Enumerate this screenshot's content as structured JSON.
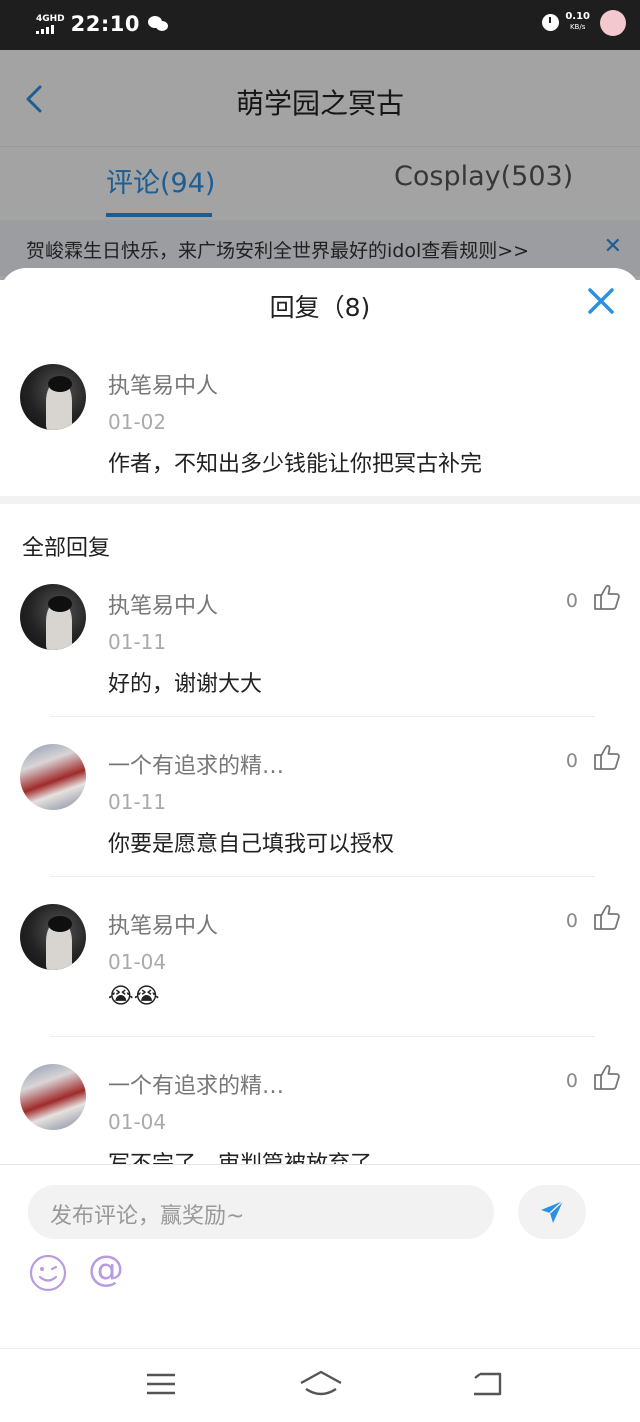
{
  "status_bar": {
    "network": "4GHD",
    "time": "22:10",
    "speed_value": "0.10",
    "speed_unit": "KB/s"
  },
  "header": {
    "title": "萌学园之冥古",
    "back_icon": "chevron-left-icon"
  },
  "tabs": [
    {
      "label": "评论(94)",
      "active": true
    },
    {
      "label": "Cosplay(503)",
      "active": false
    }
  ],
  "notice": {
    "text": "贺峻霖生日快乐，来广场安利全世界最好的idol查看规则>>",
    "close_icon": "close-icon"
  },
  "reply_sheet": {
    "title": "回复（8)",
    "close_icon": "close-icon",
    "main_comment": {
      "author": "执笔易中人",
      "date": "01-02",
      "text": "作者，不知出多少钱能让你把冥古补完"
    },
    "all_replies_label": "全部回复",
    "replies": [
      {
        "author": "执笔易中人",
        "date": "01-11",
        "text": "好的，谢谢大大",
        "likes": "0",
        "avatar": "dark"
      },
      {
        "author": "一个有追求的精…",
        "date": "01-11",
        "text": "你要是愿意自己填我可以授权",
        "likes": "0",
        "avatar": "red"
      },
      {
        "author": "执笔易中人",
        "date": "01-04",
        "text": "😭😭",
        "likes": "0",
        "avatar": "dark"
      },
      {
        "author": "一个有追求的精…",
        "date": "01-04",
        "text": "写不完了，审判篇被放弃了",
        "likes": "0",
        "avatar": "red"
      }
    ]
  },
  "comment_bar": {
    "placeholder": "发布评论，赢奖励~",
    "send_icon": "send-icon",
    "emoji_icon": "emoji-icon",
    "mention_label": "@"
  },
  "colors": {
    "accent": "#2b8fe3",
    "emoji_purple": "#b99be0"
  }
}
